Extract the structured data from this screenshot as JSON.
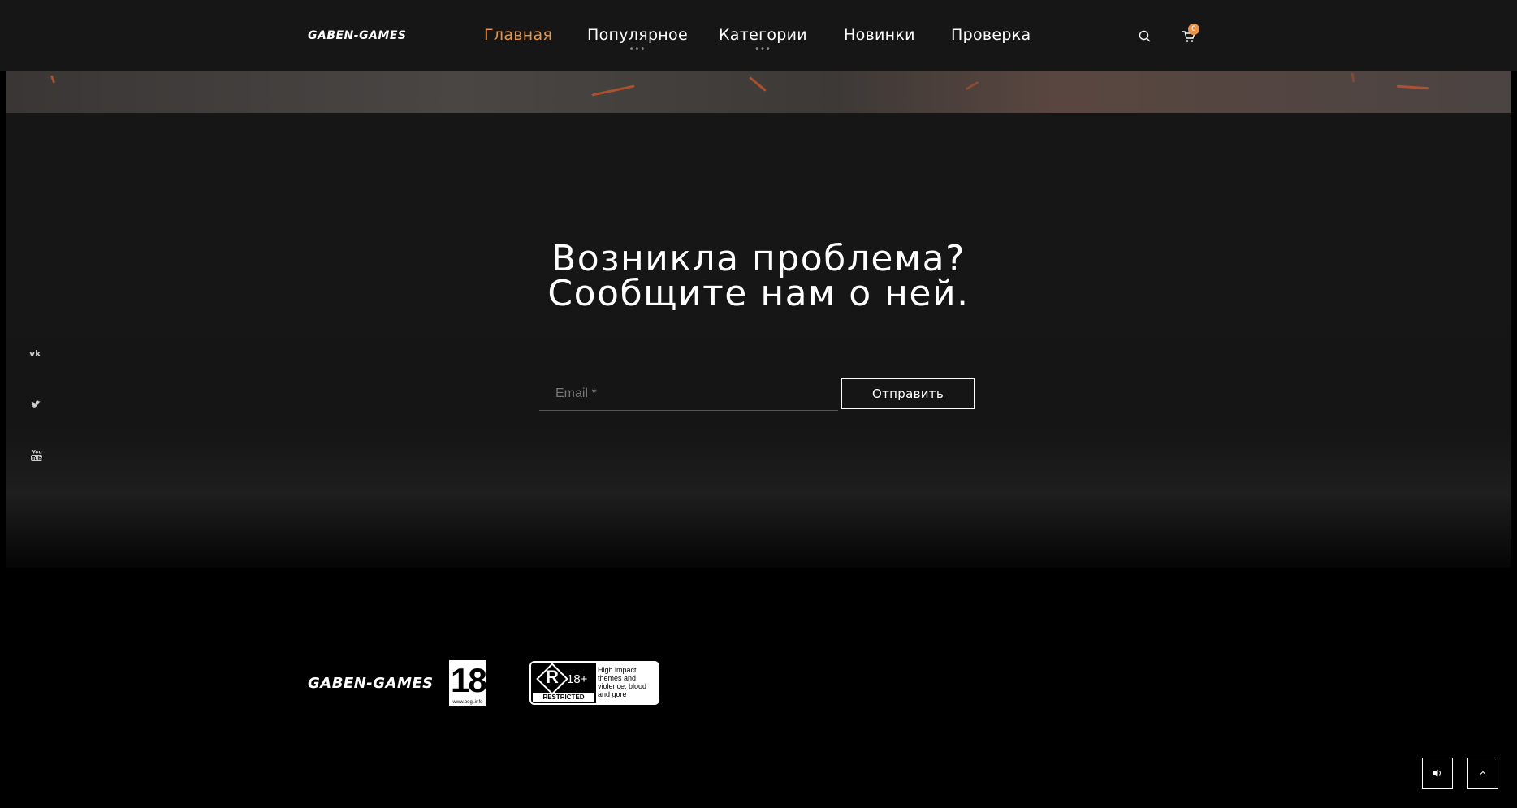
{
  "header": {
    "logo": "GABEN-GAMES",
    "nav": [
      {
        "label": "Главная",
        "active": true,
        "has_submenu": false
      },
      {
        "label": "Популярное",
        "active": false,
        "has_submenu": true
      },
      {
        "label": "Категории",
        "active": false,
        "has_submenu": true
      },
      {
        "label": "Новинки",
        "active": false,
        "has_submenu": false
      },
      {
        "label": "Проверка",
        "active": false,
        "has_submenu": false
      }
    ],
    "submenu_indicator": "•••",
    "search_icon": "search-icon",
    "cart_icon": "cart-icon",
    "cart_count": "0"
  },
  "main": {
    "headline_line1": "Возникла проблема?",
    "headline_line2": "Сообщите нам о ней.",
    "email_placeholder": "Email *",
    "submit_label": "Отправить"
  },
  "social": [
    "vk-icon",
    "twitter-icon",
    "youtube-icon"
  ],
  "footer": {
    "logo": "GABEN-GAMES",
    "pegi": {
      "age": "18",
      "site": "www.pegi.info"
    },
    "rating": {
      "letter": "R",
      "age": "18+",
      "label": "RESTRICTED",
      "description": "High impact themes and violence, blood and gore"
    }
  },
  "controls": {
    "sound_icon": "volume-icon",
    "top_icon": "chevron-up-icon"
  },
  "colors": {
    "accent": "#e8944a",
    "background": "#000000",
    "panel": "#161616",
    "text": "#ffffff"
  }
}
